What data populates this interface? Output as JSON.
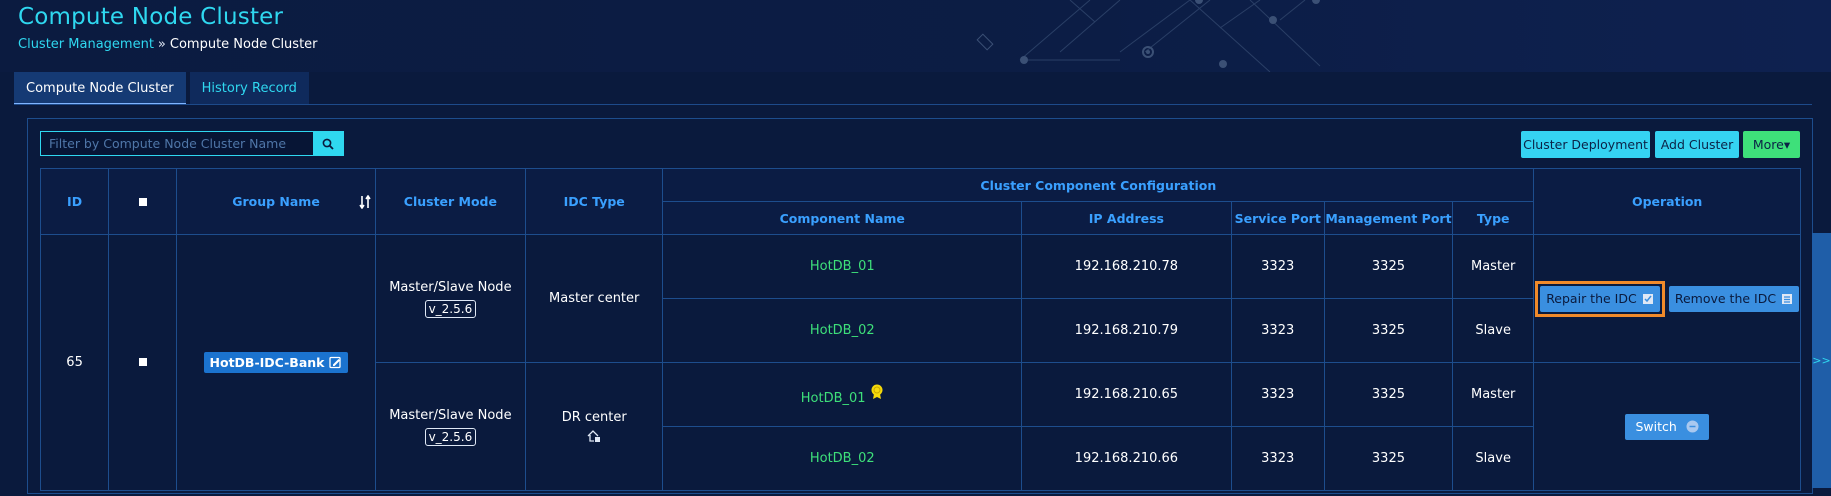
{
  "header": {
    "title": "Compute Node Cluster",
    "breadcrumb": {
      "link": "Cluster Management",
      "separator": "»",
      "current": "Compute Node Cluster"
    }
  },
  "tabs": [
    {
      "label": "Compute Node Cluster",
      "active": true
    },
    {
      "label": "History Record",
      "active": false
    }
  ],
  "toolbar": {
    "search_placeholder": "Filter by Compute Node Cluster Name",
    "search_value": "",
    "deploy_label": "Cluster Deployment",
    "add_label": "Add Cluster",
    "more_label": "More",
    "more_caret": "▾"
  },
  "table": {
    "headers": {
      "id": "ID",
      "group_name": "Group Name",
      "cluster_mode": "Cluster Mode",
      "idc_type": "IDC Type",
      "component_config": "Cluster Component Configuration",
      "component_name": "Component Name",
      "ip": "IP Address",
      "service_port": "Service Port",
      "management_port": "Management Port",
      "type": "Type",
      "operation": "Operation"
    },
    "row": {
      "id": "65",
      "group_name": "HotDB-IDC-Bank",
      "idcs": [
        {
          "mode": "Master/Slave Node",
          "version": "v_2.5.6",
          "idc_type": "Master center",
          "components": [
            {
              "name": "HotDB_01",
              "ip": "192.168.210.78",
              "service_port": "3323",
              "management_port": "3325",
              "type": "Master"
            },
            {
              "name": "HotDB_02",
              "ip": "192.168.210.79",
              "service_port": "3323",
              "management_port": "3325",
              "type": "Slave"
            }
          ],
          "operations": [
            "Repair the IDC",
            "Remove the IDC"
          ]
        },
        {
          "mode": "Master/Slave Node",
          "version": "v_2.5.6",
          "idc_type": "DR center",
          "components": [
            {
              "name": "HotDB_01",
              "ip": "192.168.210.65",
              "service_port": "3323",
              "management_port": "3325",
              "type": "Master"
            },
            {
              "name": "HotDB_02",
              "ip": "192.168.210.66",
              "service_port": "3323",
              "management_port": "3325",
              "type": "Slave"
            }
          ],
          "operations": [
            "Switch"
          ]
        }
      ]
    }
  },
  "side_toggle": ">>",
  "colors": {
    "accent": "#2fd8f0",
    "header_blue": "#3aa0ff",
    "green": "#3ee07a",
    "highlight": "#f08a2a"
  }
}
